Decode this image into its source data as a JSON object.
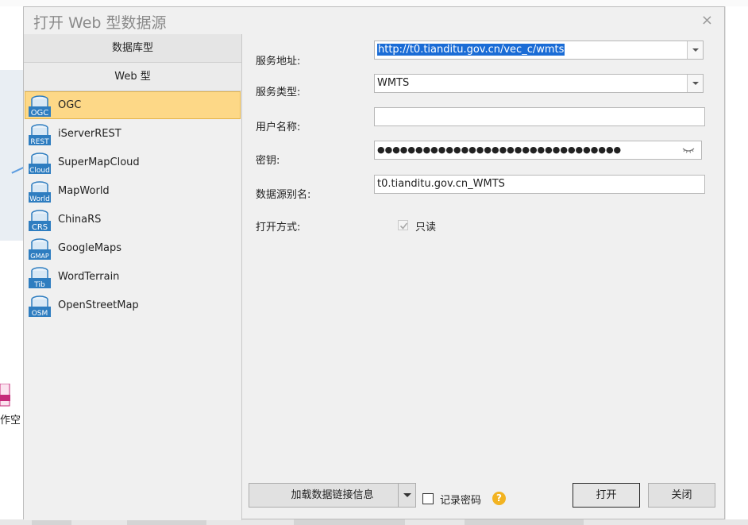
{
  "dialog": {
    "title": "打开 Web 型数据源",
    "close_glyph": "×"
  },
  "categories": {
    "database": "数据库型",
    "web": "Web 型"
  },
  "sources": [
    {
      "label": "OGC",
      "icon": "ogc-db-icon",
      "badge": "OGC",
      "selected": true
    },
    {
      "label": "iServerREST",
      "icon": "rest-db-icon",
      "badge": "REST",
      "selected": false
    },
    {
      "label": "SuperMapCloud",
      "icon": "cloud-db-icon",
      "badge": "Cloud",
      "selected": false
    },
    {
      "label": "MapWorld",
      "icon": "mapworld-db-icon",
      "badge": "World",
      "selected": false
    },
    {
      "label": "ChinaRS",
      "icon": "chinars-db-icon",
      "badge": "CRS",
      "selected": false
    },
    {
      "label": "GoogleMaps",
      "icon": "googlemaps-db-icon",
      "badge": "GMAP",
      "selected": false
    },
    {
      "label": "WordTerrain",
      "icon": "terrain-db-icon",
      "badge": "Tib",
      "selected": false
    },
    {
      "label": "OpenStreetMap",
      "icon": "osm-db-icon",
      "badge": "OSM",
      "selected": false
    }
  ],
  "form": {
    "service_url_label": "服务地址:",
    "service_url_value": "http://t0.tianditu.gov.cn/vec_c/wmts",
    "service_type_label": "服务类型:",
    "service_type_value": "WMTS",
    "username_label": "用户名称:",
    "username_value": "",
    "key_label": "密钥:",
    "key_value": "●●●●●●●●●●●●●●●●●●●●●●●●●●●●●●●●",
    "alias_label": "数据源别名:",
    "alias_value": "t0.tianditu.gov.cn_WMTS",
    "open_mode_label": "打开方式:",
    "readonly_label": "只读"
  },
  "footer": {
    "load_link_button": "加载数据链接信息",
    "remember_password": "记录密码",
    "help_glyph": "?",
    "open_button": "打开",
    "close_button": "关闭"
  },
  "background": {
    "file_label": "作空"
  },
  "colors": {
    "selection_fill": "#fdd887",
    "selection_border": "#e5b44a",
    "text_highlight": "#1a6cd6",
    "db_icon_blue": "#2e7dc0",
    "help_icon": "#f2b321"
  }
}
